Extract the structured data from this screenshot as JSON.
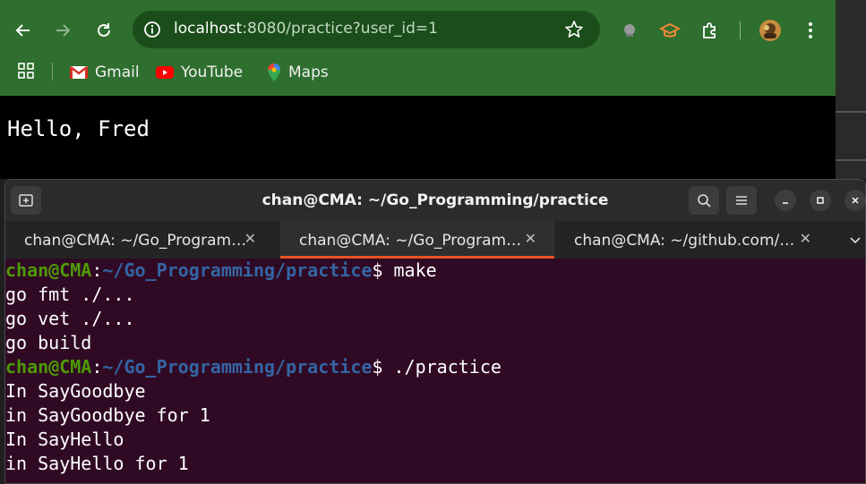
{
  "browser": {
    "url_host": "localhost",
    "url_rest": ":8080/practice?user_id=1",
    "bookmarks": [
      {
        "label": "Gmail",
        "icon": "gmail-icon"
      },
      {
        "label": "YouTube",
        "icon": "youtube-icon"
      },
      {
        "label": "Maps",
        "icon": "maps-icon"
      }
    ],
    "page_text": "Hello, Fred",
    "theme_color": "#2e6e2e"
  },
  "terminal": {
    "title": "chan@CMA: ~/Go_Programming/practice",
    "tabs": [
      {
        "label": "chan@CMA: ~/Go_Program…",
        "active": false
      },
      {
        "label": "chan@CMA: ~/Go_Program…",
        "active": true
      },
      {
        "label": "chan@CMA: ~/github.com/…",
        "active": false
      }
    ],
    "prompt_user": "chan@CMA",
    "prompt_sep": ":",
    "prompt_path": "~/Go_Programming/practice",
    "prompt_dollar": "$ ",
    "commands": [
      "make",
      "./practice"
    ],
    "output": [
      "go fmt ./...",
      "go vet ./...",
      "go build",
      "In SayGoodbye",
      "in SayGoodbye for 1",
      "In SayHello",
      "in SayHello for 1"
    ],
    "accent_color": "#e95420",
    "background_color": "#300a24"
  }
}
